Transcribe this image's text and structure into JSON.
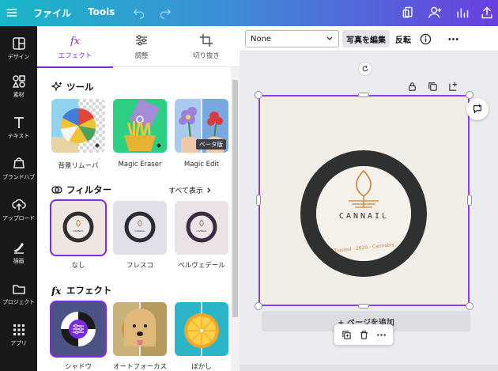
{
  "topbar": {
    "file_label": "ファイル",
    "tools_label": "Tools"
  },
  "rail": {
    "items": [
      {
        "label": "デザイン",
        "icon": "layout-icon"
      },
      {
        "label": "素材",
        "icon": "elements-icon"
      },
      {
        "label": "テキスト",
        "icon": "text-icon"
      },
      {
        "label": "ブランドハブ",
        "icon": "brand-icon"
      },
      {
        "label": "アップロード",
        "icon": "upload-icon"
      },
      {
        "label": "描画",
        "icon": "draw-icon"
      },
      {
        "label": "プロジェクト",
        "icon": "folder-icon"
      },
      {
        "label": "アプリ",
        "icon": "apps-icon"
      }
    ]
  },
  "panel": {
    "tabs": [
      {
        "label": "エフェクト",
        "active": true
      },
      {
        "label": "調整",
        "active": false
      },
      {
        "label": "切り抜き",
        "active": false
      }
    ],
    "tools_title": "ツール",
    "tools": [
      {
        "label": "背景リムーバ"
      },
      {
        "label": "Magic Eraser"
      },
      {
        "label": "Magic Edit",
        "badge": "ベータ版"
      }
    ],
    "filters_title": "フィルター",
    "see_all": "すべて表示",
    "filters": [
      {
        "label": "なし",
        "selected": true
      },
      {
        "label": "フレスコ"
      },
      {
        "label": "ベルヴェデール"
      }
    ],
    "effects_title": "エフェクト",
    "effects": [
      {
        "label": "シャドウ"
      },
      {
        "label": "オートフォーカス"
      },
      {
        "label": "ぼかし"
      }
    ]
  },
  "toolbar": {
    "select_value": "None",
    "edit_photo_label": "写真を編集",
    "flip_label": "反転"
  },
  "canvas": {
    "logo_text": "CANNAIL",
    "logo_subtext": "Trusted · 2020 · Cannabis",
    "add_page_label": "+ ページを追加"
  },
  "colors": {
    "accent": "#7d2ae8",
    "ring": "#2f3030",
    "gold": "#c9823a"
  }
}
